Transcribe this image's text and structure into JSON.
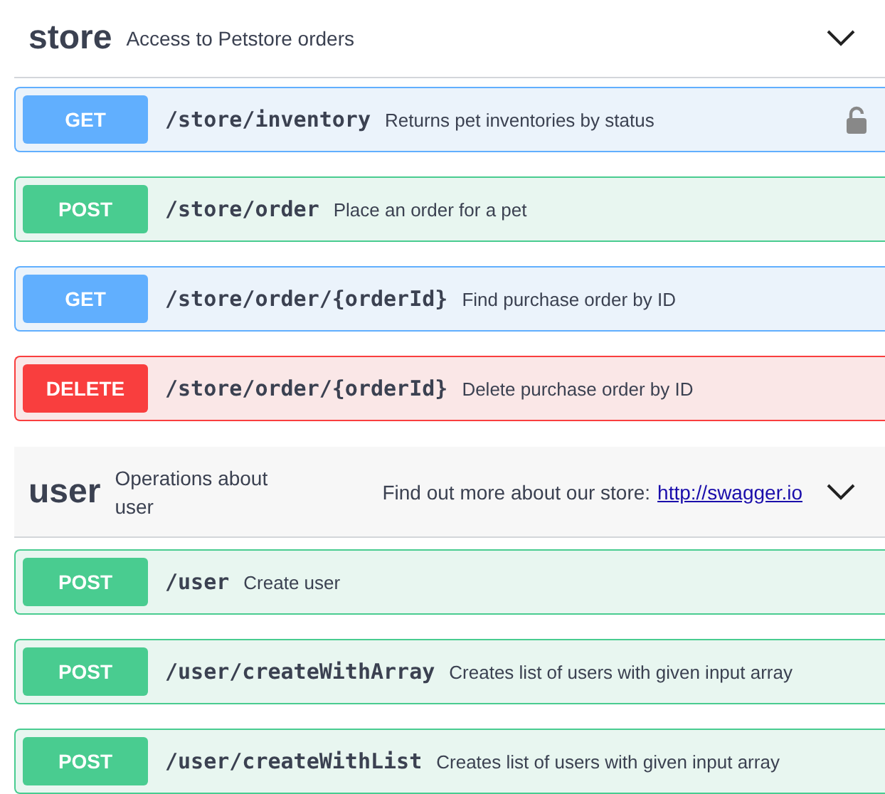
{
  "sections": [
    {
      "name": "store",
      "description": "Access to Petstore orders",
      "operations": [
        {
          "method": "GET",
          "kind": "get",
          "path": "/store/inventory",
          "summary": "Returns pet inventories by status",
          "secured": true
        },
        {
          "method": "POST",
          "kind": "post",
          "path": "/store/order",
          "summary": "Place an order for a pet",
          "secured": false
        },
        {
          "method": "GET",
          "kind": "get",
          "path": "/store/order/{orderId}",
          "summary": "Find purchase order by ID",
          "secured": false
        },
        {
          "method": "DELETE",
          "kind": "delete",
          "path": "/store/order/{orderId}",
          "summary": "Delete purchase order by ID",
          "secured": false
        }
      ]
    },
    {
      "name": "user",
      "description": "Operations about user",
      "docs_text": "Find out more about our store:",
      "docs_link": "http://swagger.io",
      "operations": [
        {
          "method": "POST",
          "kind": "post",
          "path": "/user",
          "summary": "Create user",
          "secured": false
        },
        {
          "method": "POST",
          "kind": "post",
          "path": "/user/createWithArray",
          "summary": "Creates list of users with given input array",
          "secured": false
        },
        {
          "method": "POST",
          "kind": "post",
          "path": "/user/createWithList",
          "summary": "Creates list of users with given input array",
          "secured": false
        }
      ]
    }
  ]
}
